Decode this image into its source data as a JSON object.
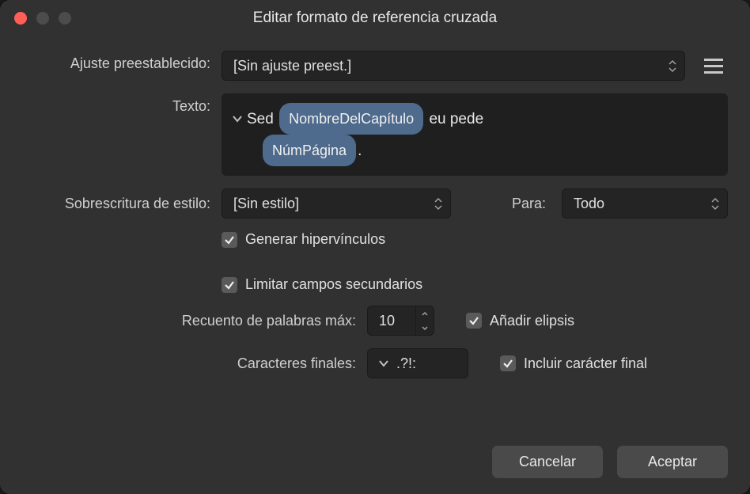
{
  "window": {
    "title": "Editar formato de referencia cruzada"
  },
  "labels": {
    "preset": "Ajuste preestablecido:",
    "text": "Texto:",
    "style_override": "Sobrescritura de estilo:",
    "for": "Para:",
    "max_words": "Recuento de palabras máx:",
    "end_chars": "Caracteres finales:"
  },
  "fields": {
    "preset_value": "[Sin ajuste preest.]",
    "style_value": "[Sin estilo]",
    "for_value": "Todo",
    "max_words_value": "10",
    "end_chars_value": ".?!:"
  },
  "text_editor": {
    "prefix": "Sed ",
    "token1": "NombreDelCapítulo",
    "mid": " eu pede ",
    "token2": "NúmPágina",
    "suffix": "."
  },
  "checkboxes": {
    "generate_hyperlinks": "Generar hipervínculos",
    "limit_subfields": "Limitar campos secundarios",
    "add_ellipsis": "Añadir elipsis",
    "include_end_char": "Incluir carácter final"
  },
  "buttons": {
    "cancel": "Cancelar",
    "accept": "Aceptar"
  }
}
